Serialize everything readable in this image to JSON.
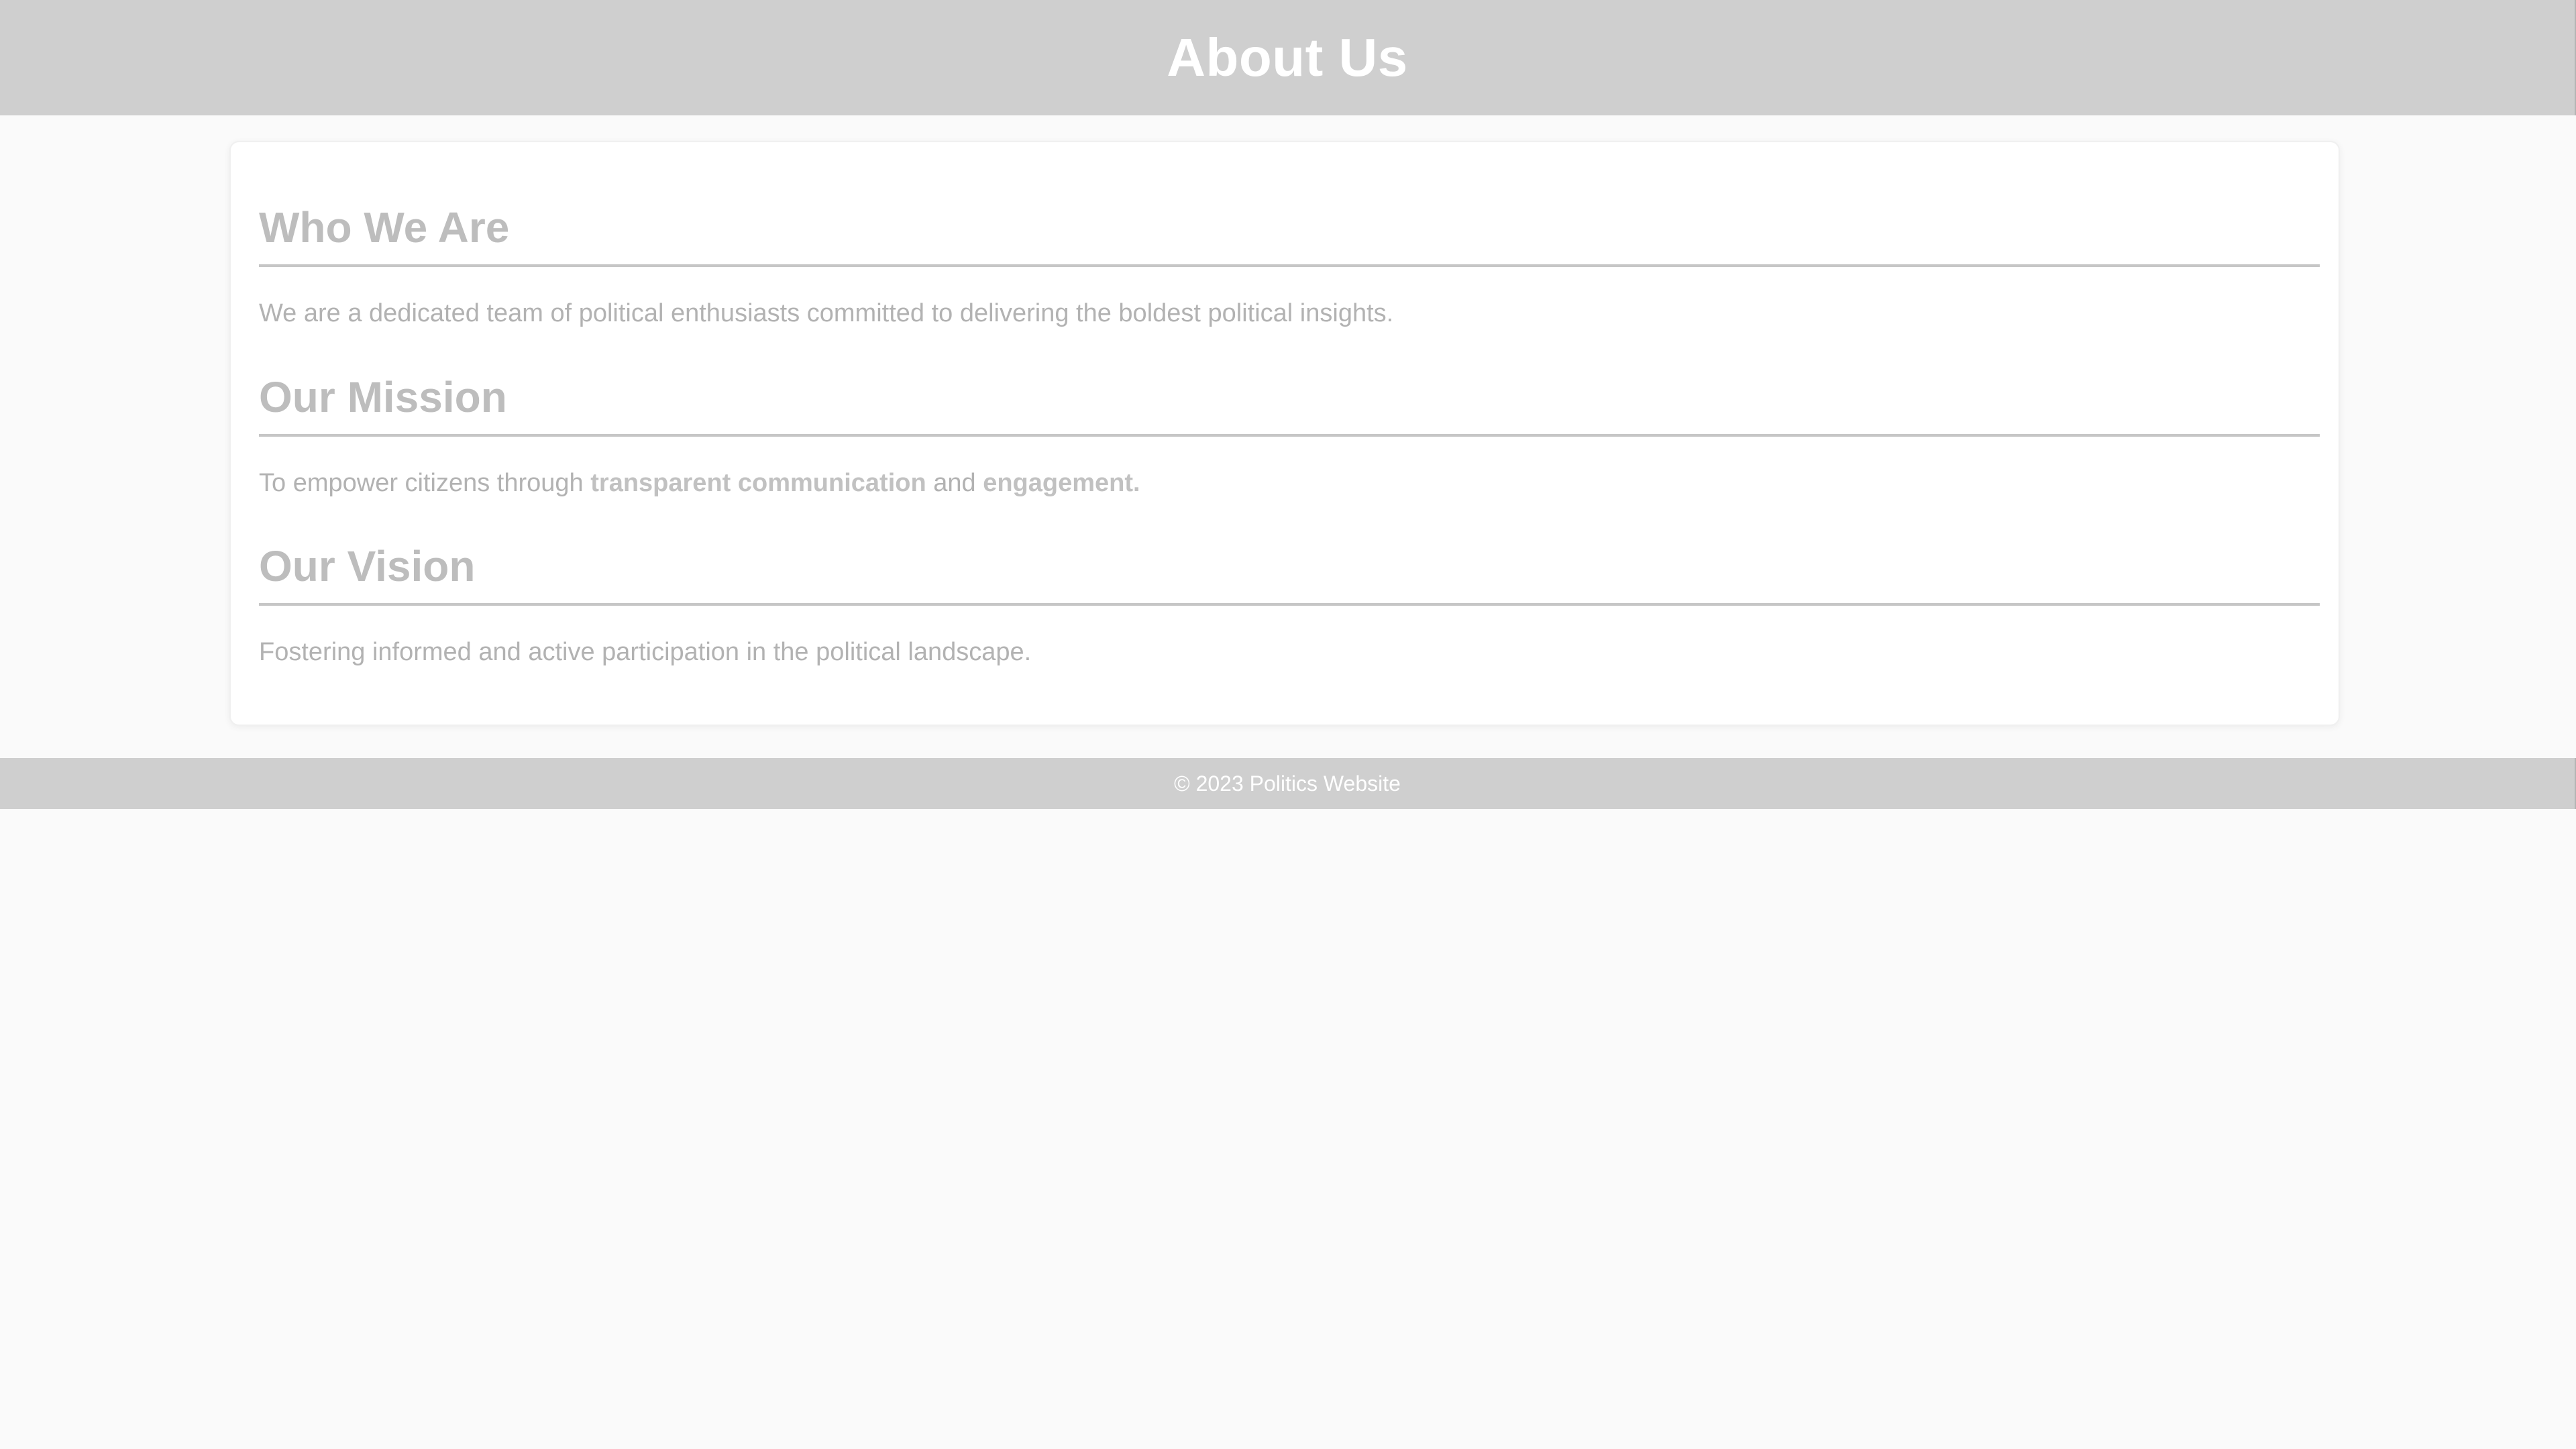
{
  "header": {
    "title": "About Us"
  },
  "sections": [
    {
      "heading": "Who We Are",
      "text": "We are a dedicated team of political enthusiasts committed to delivering the boldest political insights."
    },
    {
      "heading": "Our Mission",
      "text_before": "To empower citizens through ",
      "bold_1": "transparent communication",
      "text_middle": " and ",
      "bold_2": "engagement."
    },
    {
      "heading": "Our Vision",
      "text": "Fostering informed and active participation in the political landscape."
    }
  ],
  "footer": {
    "copyright": "© 2023 Politics Website"
  },
  "colors": {
    "header_bg": "#cfcfcf",
    "page_bg": "#fafafa",
    "card_bg": "#ffffff",
    "heading_text": "#bdbdbd",
    "body_text": "#b2b2b2"
  }
}
